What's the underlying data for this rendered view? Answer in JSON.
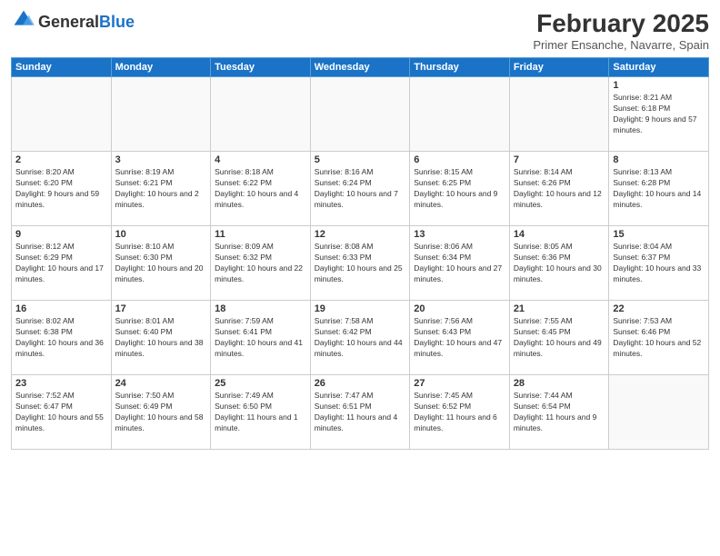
{
  "header": {
    "logo_general": "General",
    "logo_blue": "Blue",
    "month_title": "February 2025",
    "subtitle": "Primer Ensanche, Navarre, Spain"
  },
  "days_of_week": [
    "Sunday",
    "Monday",
    "Tuesday",
    "Wednesday",
    "Thursday",
    "Friday",
    "Saturday"
  ],
  "weeks": [
    [
      {
        "day": "",
        "info": ""
      },
      {
        "day": "",
        "info": ""
      },
      {
        "day": "",
        "info": ""
      },
      {
        "day": "",
        "info": ""
      },
      {
        "day": "",
        "info": ""
      },
      {
        "day": "",
        "info": ""
      },
      {
        "day": "1",
        "info": "Sunrise: 8:21 AM\nSunset: 6:18 PM\nDaylight: 9 hours and 57 minutes."
      }
    ],
    [
      {
        "day": "2",
        "info": "Sunrise: 8:20 AM\nSunset: 6:20 PM\nDaylight: 9 hours and 59 minutes."
      },
      {
        "day": "3",
        "info": "Sunrise: 8:19 AM\nSunset: 6:21 PM\nDaylight: 10 hours and 2 minutes."
      },
      {
        "day": "4",
        "info": "Sunrise: 8:18 AM\nSunset: 6:22 PM\nDaylight: 10 hours and 4 minutes."
      },
      {
        "day": "5",
        "info": "Sunrise: 8:16 AM\nSunset: 6:24 PM\nDaylight: 10 hours and 7 minutes."
      },
      {
        "day": "6",
        "info": "Sunrise: 8:15 AM\nSunset: 6:25 PM\nDaylight: 10 hours and 9 minutes."
      },
      {
        "day": "7",
        "info": "Sunrise: 8:14 AM\nSunset: 6:26 PM\nDaylight: 10 hours and 12 minutes."
      },
      {
        "day": "8",
        "info": "Sunrise: 8:13 AM\nSunset: 6:28 PM\nDaylight: 10 hours and 14 minutes."
      }
    ],
    [
      {
        "day": "9",
        "info": "Sunrise: 8:12 AM\nSunset: 6:29 PM\nDaylight: 10 hours and 17 minutes."
      },
      {
        "day": "10",
        "info": "Sunrise: 8:10 AM\nSunset: 6:30 PM\nDaylight: 10 hours and 20 minutes."
      },
      {
        "day": "11",
        "info": "Sunrise: 8:09 AM\nSunset: 6:32 PM\nDaylight: 10 hours and 22 minutes."
      },
      {
        "day": "12",
        "info": "Sunrise: 8:08 AM\nSunset: 6:33 PM\nDaylight: 10 hours and 25 minutes."
      },
      {
        "day": "13",
        "info": "Sunrise: 8:06 AM\nSunset: 6:34 PM\nDaylight: 10 hours and 27 minutes."
      },
      {
        "day": "14",
        "info": "Sunrise: 8:05 AM\nSunset: 6:36 PM\nDaylight: 10 hours and 30 minutes."
      },
      {
        "day": "15",
        "info": "Sunrise: 8:04 AM\nSunset: 6:37 PM\nDaylight: 10 hours and 33 minutes."
      }
    ],
    [
      {
        "day": "16",
        "info": "Sunrise: 8:02 AM\nSunset: 6:38 PM\nDaylight: 10 hours and 36 minutes."
      },
      {
        "day": "17",
        "info": "Sunrise: 8:01 AM\nSunset: 6:40 PM\nDaylight: 10 hours and 38 minutes."
      },
      {
        "day": "18",
        "info": "Sunrise: 7:59 AM\nSunset: 6:41 PM\nDaylight: 10 hours and 41 minutes."
      },
      {
        "day": "19",
        "info": "Sunrise: 7:58 AM\nSunset: 6:42 PM\nDaylight: 10 hours and 44 minutes."
      },
      {
        "day": "20",
        "info": "Sunrise: 7:56 AM\nSunset: 6:43 PM\nDaylight: 10 hours and 47 minutes."
      },
      {
        "day": "21",
        "info": "Sunrise: 7:55 AM\nSunset: 6:45 PM\nDaylight: 10 hours and 49 minutes."
      },
      {
        "day": "22",
        "info": "Sunrise: 7:53 AM\nSunset: 6:46 PM\nDaylight: 10 hours and 52 minutes."
      }
    ],
    [
      {
        "day": "23",
        "info": "Sunrise: 7:52 AM\nSunset: 6:47 PM\nDaylight: 10 hours and 55 minutes."
      },
      {
        "day": "24",
        "info": "Sunrise: 7:50 AM\nSunset: 6:49 PM\nDaylight: 10 hours and 58 minutes."
      },
      {
        "day": "25",
        "info": "Sunrise: 7:49 AM\nSunset: 6:50 PM\nDaylight: 11 hours and 1 minute."
      },
      {
        "day": "26",
        "info": "Sunrise: 7:47 AM\nSunset: 6:51 PM\nDaylight: 11 hours and 4 minutes."
      },
      {
        "day": "27",
        "info": "Sunrise: 7:45 AM\nSunset: 6:52 PM\nDaylight: 11 hours and 6 minutes."
      },
      {
        "day": "28",
        "info": "Sunrise: 7:44 AM\nSunset: 6:54 PM\nDaylight: 11 hours and 9 minutes."
      },
      {
        "day": "",
        "info": ""
      }
    ]
  ]
}
